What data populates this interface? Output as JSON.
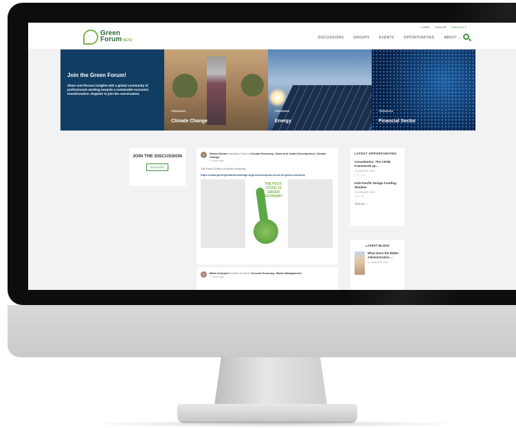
{
  "header": {
    "logo_line1": "Green",
    "logo_line2": "Forum",
    "logo_badge": "BETA",
    "util_login": "LOGIN",
    "util_signup": "SIGN UP",
    "util_lang": "ENGLISH ∨",
    "nav": [
      "DISCUSSIONS",
      "GROUPS",
      "EVENTS",
      "OPPORTUNITIES",
      "ABOUT ⌄"
    ]
  },
  "hero": {
    "join_title": "Join the Green Forum!",
    "join_text": "Share and discuss insights with a global community of professionals working towards a sustainable economic transformation. Register to join the conversation.",
    "tiles": [
      {
        "tag": "TRENDING",
        "title": "Climate Change"
      },
      {
        "tag": "TRENDING",
        "title": "Energy"
      },
      {
        "tag": "TRENDING",
        "title": "Financial Sector"
      }
    ]
  },
  "discussion": {
    "title": "JOIN THE DISCUSSION",
    "register": "REGISTER"
  },
  "feed": {
    "post1": {
      "author": "Robert Brears",
      "action": "created a Post in",
      "topics": "Circular Economy, Cities and Urban Development, Climate Change",
      "time": "3 hours ago",
      "text": "The Post-COVID-19 Green Economy",
      "link": "https://www.greengrowthknowledge.org/research/post-covid-19-green-economy",
      "poster_text": "THE POST- COVID-19 GREEN ECONOMY"
    },
    "post2": {
      "author": "Maria Dumpert",
      "action": "created a Post in",
      "topics": "Circular Economy, Waste Management",
      "time": "7 hours ago"
    }
  },
  "opportunities": {
    "title": "LATEST OPPORTUNITIES",
    "items": [
      {
        "title": "Consultation: The CDSB Framework ap...",
        "date": "19 JANUARY 2021",
        "counts": "▢ 0   ♡ 31"
      },
      {
        "title": "Indo-Pacific Design Funding Window",
        "date": "18 JANUARY 2021",
        "counts": "▢ 0   ♡ 8"
      }
    ],
    "view_all": "VIEW ALL →"
  },
  "blogs": {
    "title": "LATEST BLOGS",
    "item_title": "What Does the Biden Administration ...",
    "item_date": "21 JANUARY 2021"
  }
}
